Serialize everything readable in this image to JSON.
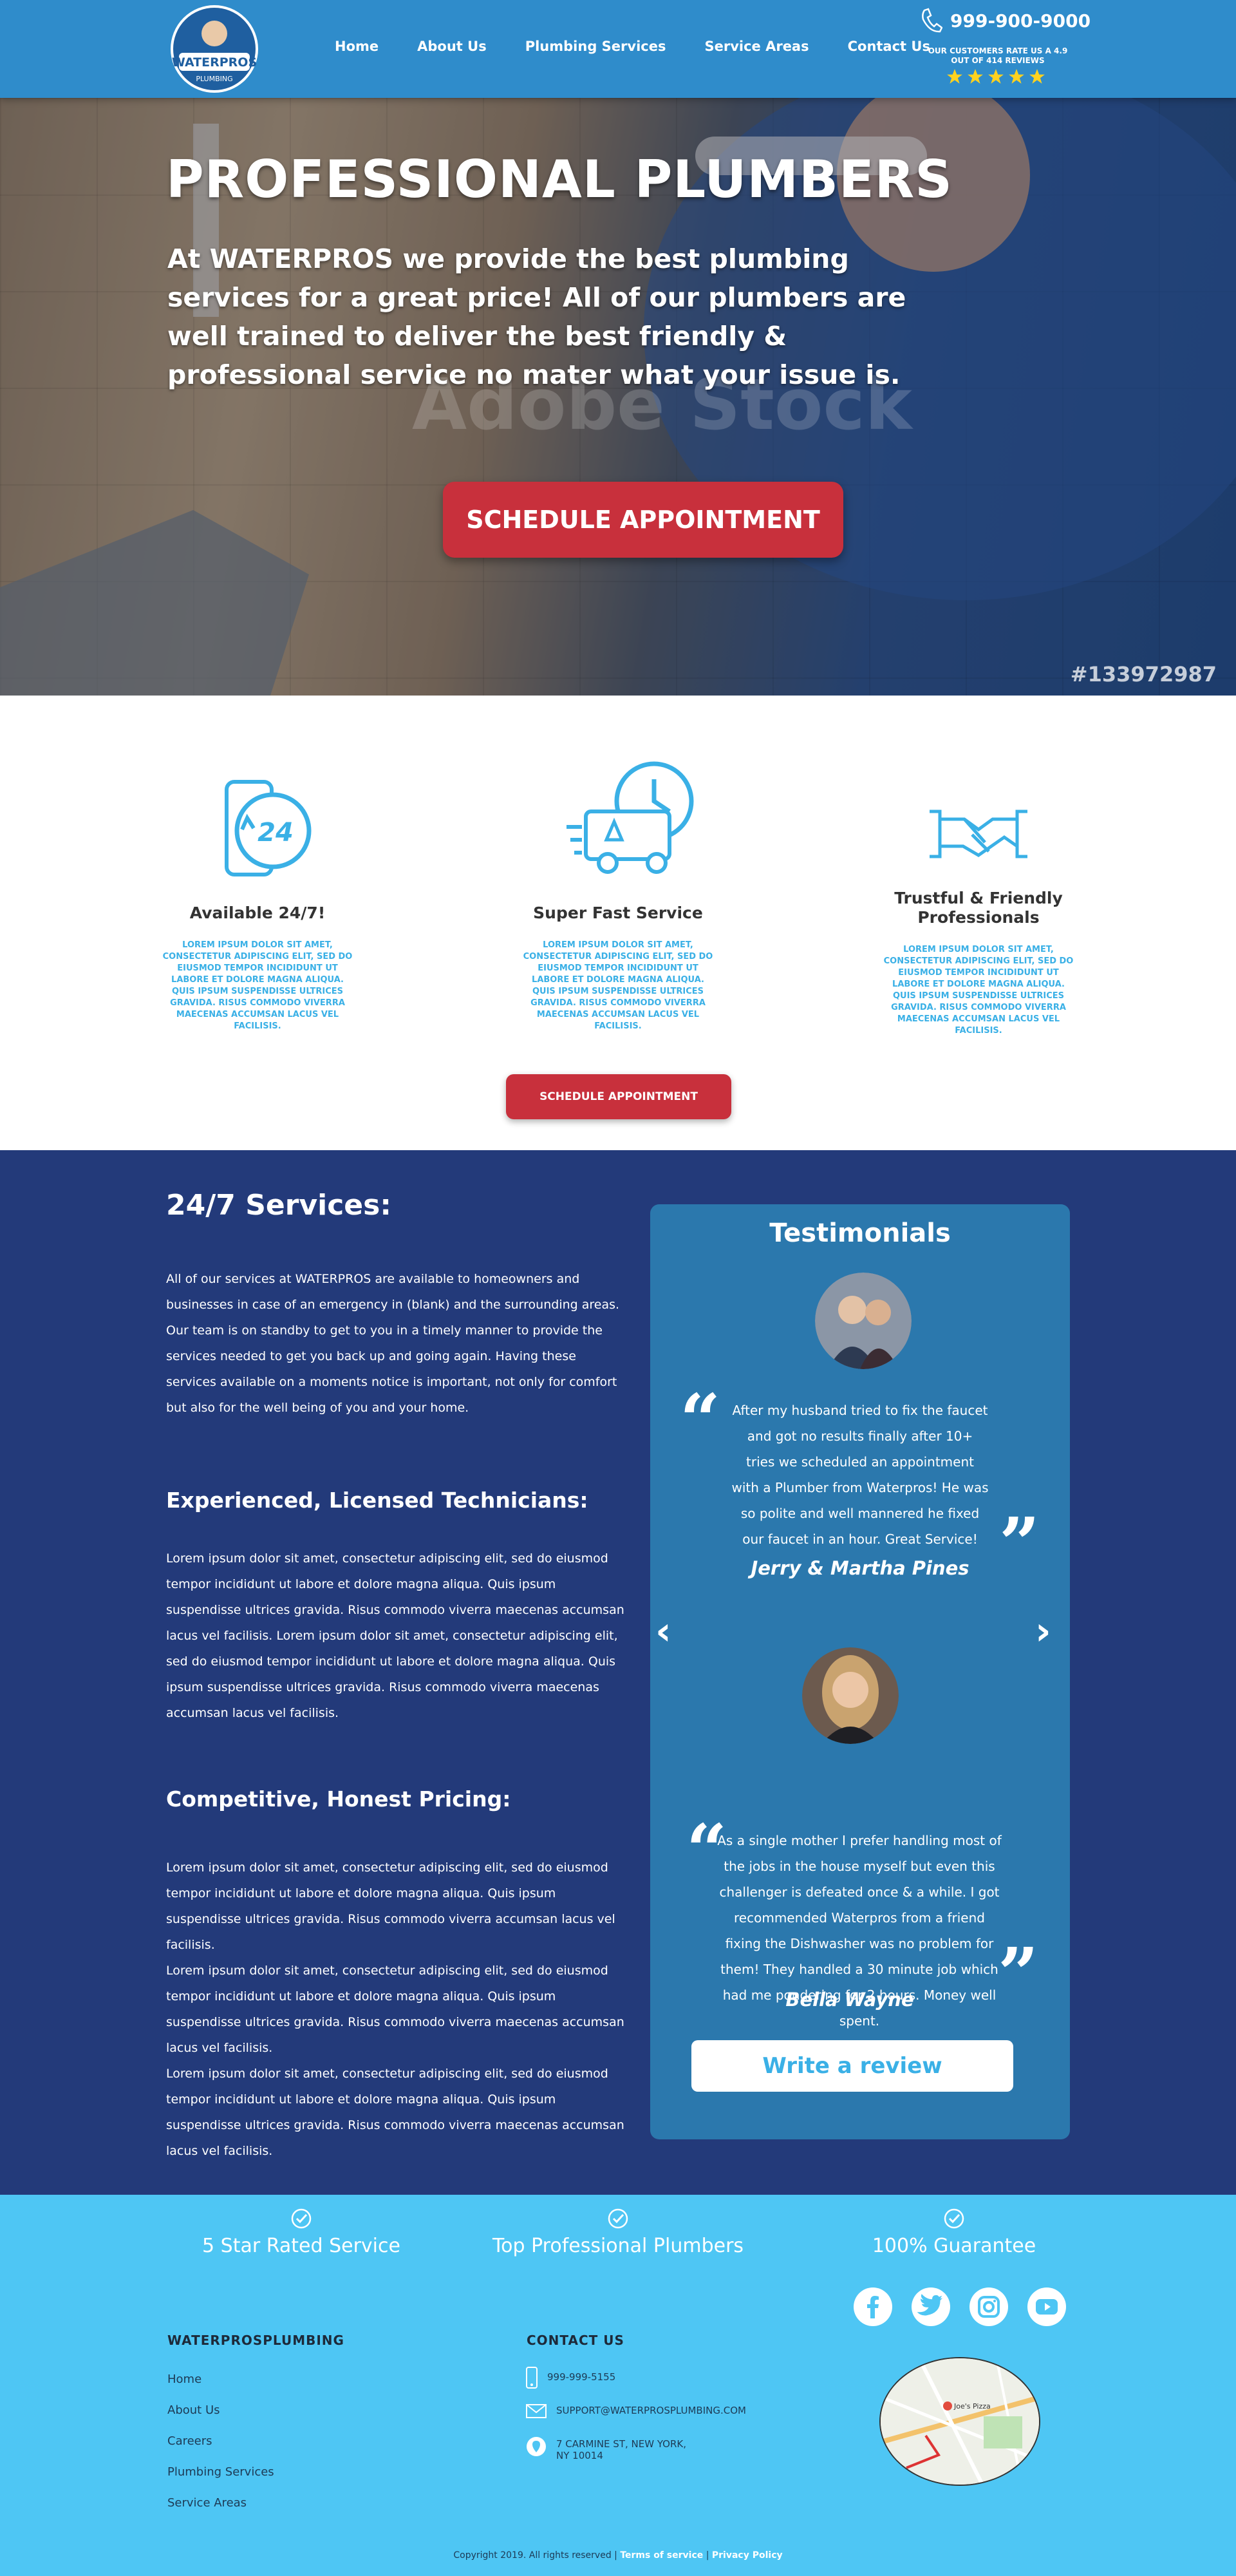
{
  "header": {
    "logo_text": "WATERPROS",
    "logo_sub": "PLUMBING",
    "nav": [
      "Home",
      "About Us",
      "Plumbing Services",
      "Service Areas",
      "Contact Us"
    ],
    "phone": "999-900-9000",
    "rating_text": "OUR CUSTOMERS RATE US A 4.9 OUT OF 414 REVIEWS",
    "stars": 5
  },
  "hero": {
    "title": "PROFESSIONAL PLUMBERS",
    "lead": "At WATERPROS we provide the best plumbing services for a great price! All of our plumbers are well trained to deliver the best friendly & professional service no mater what your issue is.",
    "watermark": "Adobe Stock",
    "stock_id": "#133972987",
    "cta": "SCHEDULE APPOINTMENT"
  },
  "features": {
    "items": [
      {
        "title": "Available 24/7!",
        "icon": "phone-24-icon",
        "text": "LOREM IPSUM DOLOR SIT AMET, CONSECTETUR ADIPISCING ELIT, SED DO EIUSMOD TEMPOR INCIDIDUNT UT LABORE ET DOLORE MAGNA ALIQUA. QUIS IPSUM SUSPENDISSE ULTRICES GRAVIDA. RISUS COMMODO VIVERRA MAECENAS ACCUMSAN LACUS VEL FACILISIS."
      },
      {
        "title": "Super Fast Service",
        "icon": "fast-van-icon",
        "text": "LOREM IPSUM DOLOR SIT AMET, CONSECTETUR ADIPISCING ELIT, SED DO EIUSMOD TEMPOR INCIDIDUNT UT LABORE ET DOLORE MAGNA ALIQUA. QUIS IPSUM SUSPENDISSE ULTRICES GRAVIDA. RISUS COMMODO VIVERRA MAECENAS ACCUMSAN LACUS VEL FACILISIS."
      },
      {
        "title": "Trustful & Friendly Professionals",
        "icon": "handshake-icon",
        "text": "LOREM IPSUM DOLOR SIT AMET, CONSECTETUR ADIPISCING ELIT, SED DO EIUSMOD TEMPOR INCIDIDUNT UT LABORE ET DOLORE MAGNA ALIQUA. QUIS IPSUM SUSPENDISSE ULTRICES GRAVIDA. RISUS COMMODO VIVERRA MAECENAS ACCUMSAN LACUS VEL FACILISIS."
      }
    ],
    "cta": "SCHEDULE APPOINTMENT"
  },
  "services": {
    "heading": "24/7 Services:",
    "intro": "All of our services at WATERPROS are available to homeowners and businesses in case of an emergency in (blank) and the surrounding areas. Our team is on standby to get to you in a timely manner to provide the services needed to get you back up and going again. Having these services available on a moments notice is important, not only for comfort but also for the well being of you and your home.",
    "sub1": "Experienced, Licensed Technicians:",
    "text1": "Lorem ipsum dolor sit amet, consectetur adipiscing elit, sed do eiusmod tempor incididunt ut labore et dolore magna aliqua. Quis ipsum suspendisse ultrices gravida. Risus commodo viverra maecenas accumsan lacus vel facilisis. Lorem ipsum dolor sit amet, consectetur adipiscing elit, sed do eiusmod tempor incididunt ut labore et dolore magna aliqua. Quis ipsum suspendisse ultrices gravida. Risus commodo viverra maecenas accumsan lacus vel facilisis.",
    "sub2": "Competitive, Honest Pricing:",
    "text2a": "Lorem ipsum dolor sit amet, consectetur adipiscing elit, sed do eiusmod tempor incididunt ut labore et dolore magna aliqua. Quis ipsum suspendisse ultrices gravida. Risus commodo viverra accumsan lacus vel facilisis.",
    "text2b": "Lorem ipsum dolor sit amet, consectetur adipiscing elit, sed do eiusmod tempor incididunt ut labore et dolore magna aliqua. Quis ipsum suspendisse ultrices gravida. Risus commodo viverra maecenas accumsan lacus vel facilisis.",
    "text2c": "Lorem ipsum dolor sit amet, consectetur adipiscing elit, sed do eiusmod tempor incididunt ut labore et dolore magna aliqua. Quis ipsum suspendisse ultrices gravida. Risus commodo viverra maecenas accumsan lacus vel facilisis."
  },
  "testimonials": {
    "heading": "Testimonials",
    "items": [
      {
        "quote": "After my husband tried to fix the faucet and got no results finally after 10+ tries we scheduled an appointment with a Plumber from Waterpros! He was so polite and well mannered he fixed our faucet in an hour. Great Service!",
        "author": "Jerry & Martha Pines"
      },
      {
        "quote": "As a single mother I prefer handling most of the jobs in the house myself but even this challenger is defeated once & a while. I got recommended Waterpros from a friend fixing the Dishwasher was no problem for them! They handled a 30 minute job which had me pondering for 2 hours. Money well spent.",
        "author": "Bella Wayne"
      }
    ],
    "review_button": "Write a review"
  },
  "footer": {
    "badges": [
      "5 Star Rated Service",
      "Top Professional Plumbers",
      "100% Guarantee"
    ],
    "col1_title": "WATERPROSPLUMBING",
    "links": [
      "Home",
      "About Us",
      "Careers",
      "Plumbing Services",
      "Service Areas"
    ],
    "col2_title": "CONTACT US",
    "phone": "999-999-5155",
    "email": "SUPPORT@WATERPROSPLUMBING.COM",
    "address_line1": "7 CARMINE ST, NEW YORK,",
    "address_line2": "NY 10014",
    "map_label": "Joe's Pizza",
    "copyright": "Copyright 2019. All rights reserved |",
    "terms": "Terms of service",
    "privacy": "Privacy Policy"
  },
  "colors": {
    "header_blue": "#2f8ccb",
    "accent_red": "#c8303c",
    "navy": "#233a7a",
    "testimonial_blue": "#2b78ad",
    "footer_cyan": "#4ec6f4",
    "icon_blue": "#3ab0e6",
    "star_yellow": "#ffd21f"
  }
}
